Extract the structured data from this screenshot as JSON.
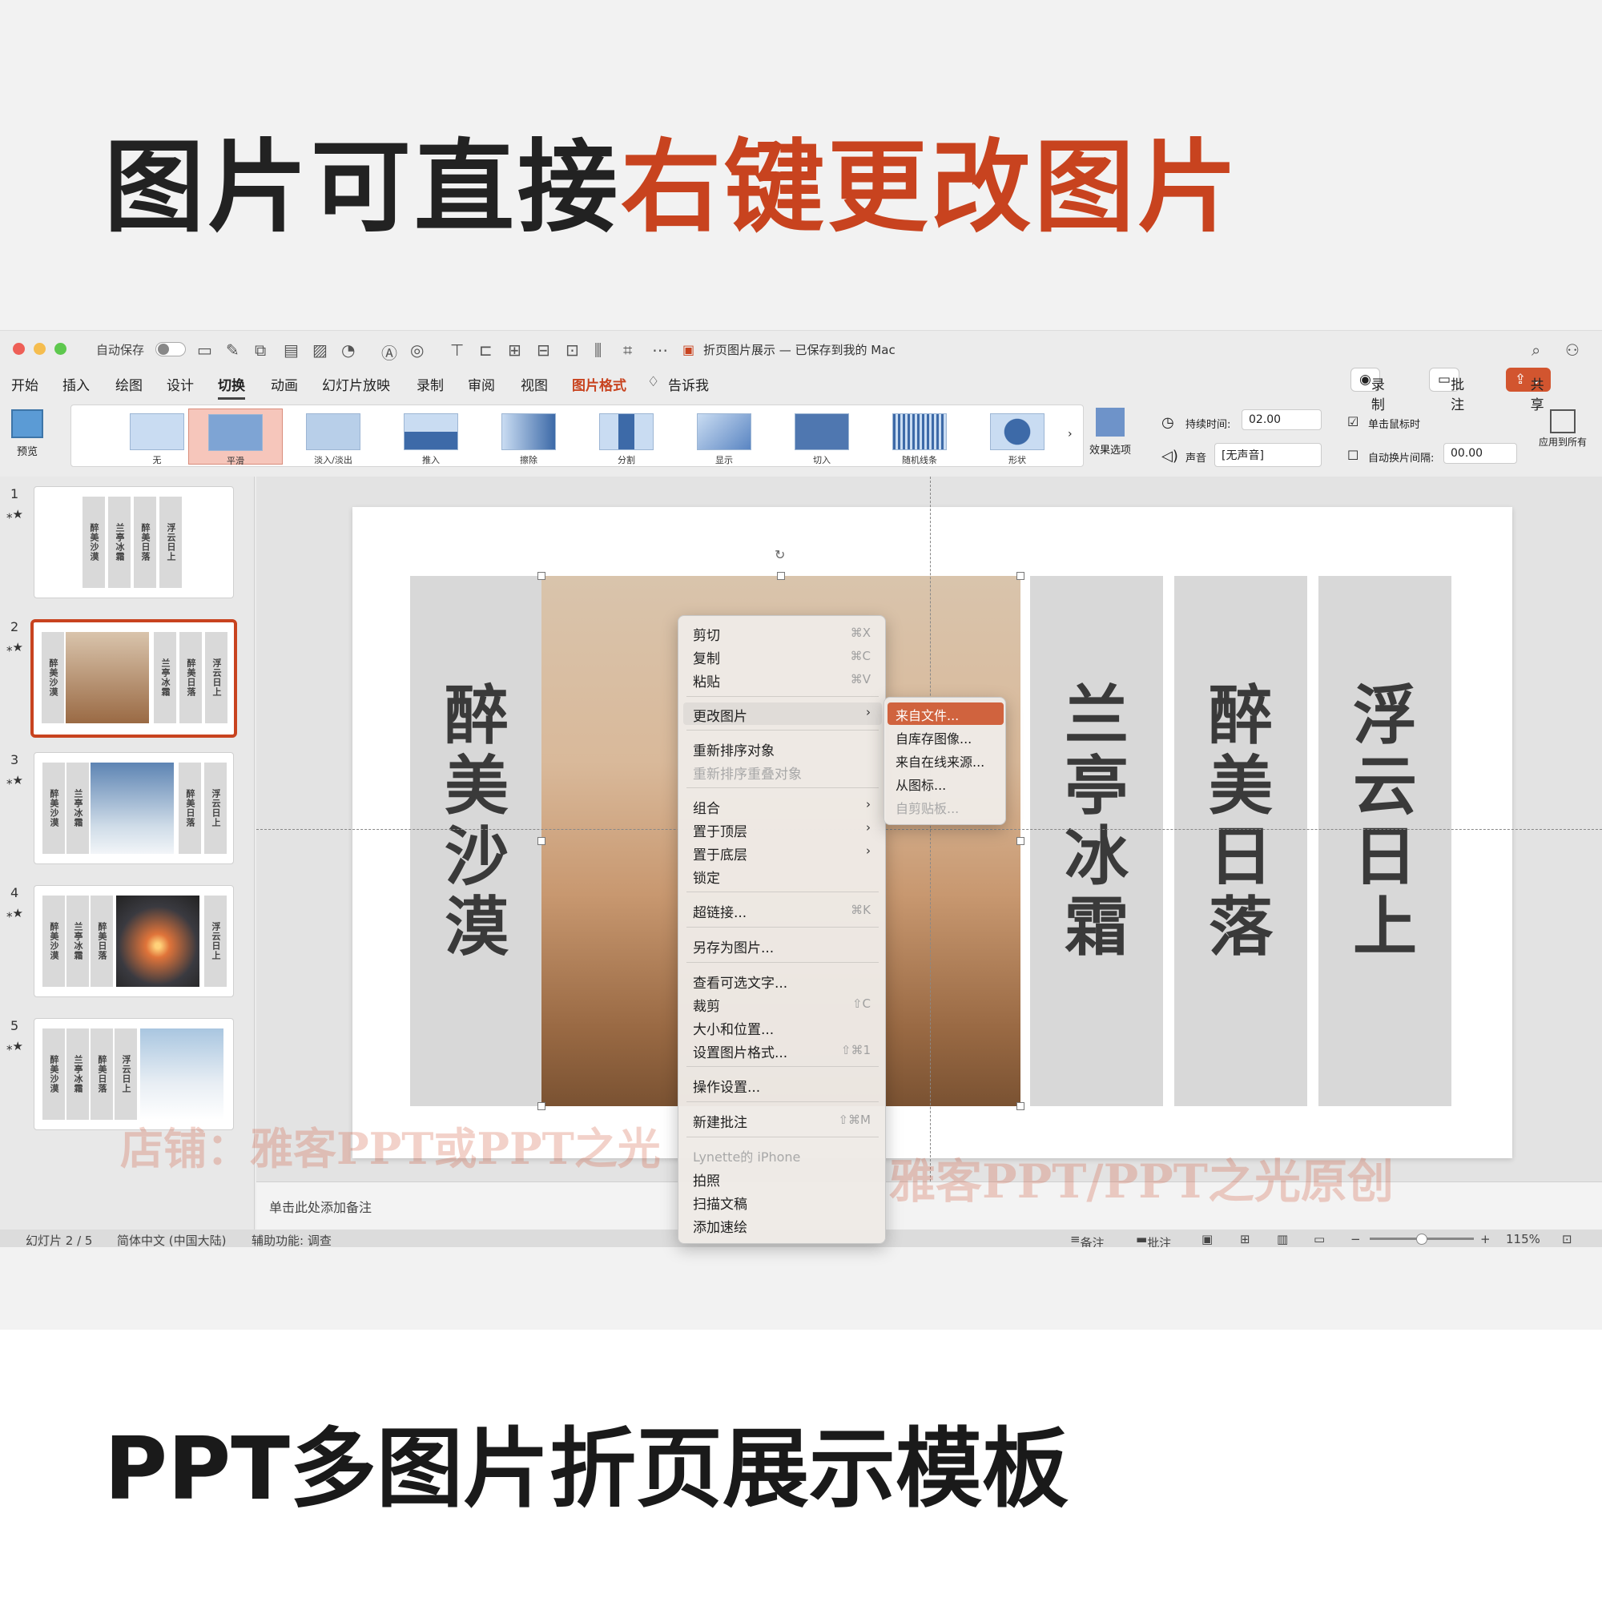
{
  "headline": {
    "part1": "图片可直接",
    "part2": "右键更改图片"
  },
  "footline": "PPT多图片折页展示模板",
  "window": {
    "autosave_label": "自动保存",
    "doc_title": "折页图片展示 — 已保存到我的 Mac",
    "menu": [
      "开始",
      "插入",
      "绘图",
      "设计",
      "切换",
      "动画",
      "幻灯片放映",
      "录制",
      "审阅",
      "视图",
      "图片格式",
      "告诉我"
    ],
    "buttons": {
      "record": "录制",
      "comment": "批注",
      "share": "共享"
    }
  },
  "ribbon": {
    "preview": "预览",
    "transitions": [
      "无",
      "平滑",
      "淡入/淡出",
      "推入",
      "擦除",
      "分割",
      "显示",
      "切入",
      "随机线条",
      "形状"
    ],
    "effects": "效果选项",
    "duration_label": "持续时间:",
    "duration_value": "02.00",
    "sound_label": "声音",
    "sound_value": "[无声音]",
    "on_click": "单击鼠标时",
    "auto_after": "自动换片间隔:",
    "auto_value": "00.00",
    "apply_all": "应用到所有"
  },
  "thumbnails": [
    {
      "num": "1",
      "strips": [
        "醉美沙漠",
        "兰亭冰霜",
        "醉美日落",
        "浮云日上"
      ]
    },
    {
      "num": "2",
      "strips": [
        "醉美沙漠",
        "兰亭冰霜",
        "醉美日落",
        "浮云日上"
      ]
    },
    {
      "num": "3",
      "strips": [
        "醉美沙漠",
        "兰亭冰霜",
        "醉美日落",
        "浮云日上"
      ]
    },
    {
      "num": "4",
      "strips": [
        "醉美沙漠",
        "兰亭冰霜",
        "醉美日落",
        "浮云日上"
      ]
    },
    {
      "num": "5",
      "strips": [
        "醉美沙漠",
        "兰亭冰霜",
        "醉美日落",
        "浮云日上"
      ]
    }
  ],
  "slide": {
    "panels": [
      "醉美沙漠",
      "兰亭冰霜",
      "醉美日落",
      "浮云日上"
    ]
  },
  "context_menu": {
    "cut": "剪切",
    "cut_sc": "⌘X",
    "copy": "复制",
    "copy_sc": "⌘C",
    "paste": "粘贴",
    "paste_sc": "⌘V",
    "change_pic": "更改图片",
    "reorder": "重新排序对象",
    "reorder_overlap": "重新排序重叠对象",
    "group": "组合",
    "bring_front": "置于顶层",
    "send_back": "置于底层",
    "lock": "锁定",
    "hyperlink": "超链接...",
    "hyperlink_sc": "⌘K",
    "save_as_pic": "另存为图片...",
    "alt_text": "查看可选文字...",
    "crop": "裁剪",
    "crop_sc": "⇧C",
    "size_pos": "大小和位置...",
    "format_pic": "设置图片格式...",
    "format_sc": "⇧⌘1",
    "action": "操作设置...",
    "new_comment": "新建批注",
    "new_comment_sc": "⇧⌘M",
    "iphone": "Lynette的 iPhone",
    "photo": "拍照",
    "scan": "扫描文稿",
    "sketch": "添加速绘"
  },
  "submenu": {
    "from_file": "来自文件...",
    "from_library": "自库存图像...",
    "online": "来自在线来源...",
    "icons": "从图标...",
    "clipboard": "自剪贴板..."
  },
  "notes_placeholder": "单击此处添加备注",
  "status": {
    "slide": "幻灯片 2 / 5",
    "lang": "简体中文 (中国大陆)",
    "access": "辅助功能: 调查",
    "notes": "备注",
    "comments": "批注",
    "zoom": "115%"
  },
  "watermarks": {
    "wm1": "店铺：雅客PPT或PPT之光",
    "wm2": "雅客PPT/PPT之光原创"
  },
  "colors": {
    "accent": "#c8431f",
    "submenu_highlight": "#d0633e"
  }
}
